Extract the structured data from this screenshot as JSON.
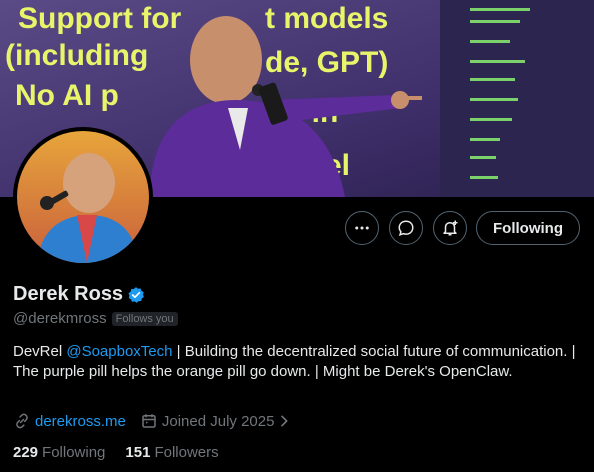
{
  "banner": {
    "slide_lines": [
      "Support for models",
      "(including ...de, GPT)",
      "No AI p...k-in",
      "...el"
    ]
  },
  "profile": {
    "display_name": "Derek Ross",
    "handle": "@derekmross",
    "follows_you": "Follows you",
    "bio_prefix": "DevRel ",
    "bio_mention": "@SoapboxTech",
    "bio_suffix": " | Building the decentralized social future of communication. | The purple pill helps the orange pill go down. | Might be Derek's OpenClaw.",
    "website": "derekross.me",
    "joined": "Joined July 2025"
  },
  "actions": {
    "follow_label": "Following",
    "more_icon": "more-icon",
    "message_icon": "message-icon",
    "notify_icon": "notification-bell-icon"
  },
  "stats": {
    "following_count": "229",
    "following_label": "Following",
    "followers_count": "151",
    "followers_label": "Followers"
  },
  "colors": {
    "accent": "#1d9bf0",
    "muted": "#71767b",
    "text": "#e7e9ea",
    "background": "#000000"
  }
}
